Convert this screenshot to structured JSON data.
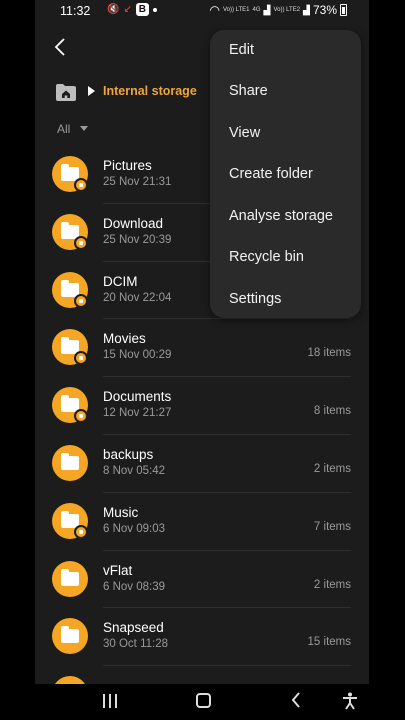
{
  "status_bar": {
    "time": "11:32",
    "battery": "73%",
    "network_labels": [
      "Vo)) LTE1",
      "4G",
      "Vo)) LTE2"
    ],
    "app_badge": "B"
  },
  "topbar": {
    "back_icon": "back-arrow-icon"
  },
  "path": {
    "home_icon": "home-folder-icon",
    "current": "Internal storage"
  },
  "filter": {
    "label": "All"
  },
  "colors": {
    "accent": "#f0a53a",
    "folder": "#f4a624",
    "background": "#1c1c1c",
    "menu_bg": "#2a2a2a"
  },
  "folders": [
    {
      "name": "Pictures",
      "date": "25 Nov 21:31",
      "count": "",
      "badge_icon": "image-icon"
    },
    {
      "name": "Download",
      "date": "25 Nov 20:39",
      "count": "",
      "badge_icon": "download-icon"
    },
    {
      "name": "DCIM",
      "date": "20 Nov 22:04",
      "count": "",
      "badge_icon": "camera-icon"
    },
    {
      "name": "Movies",
      "date": "15 Nov 00:29",
      "count": "18 items",
      "badge_icon": "play-icon"
    },
    {
      "name": "Documents",
      "date": "12 Nov 21:27",
      "count": "8 items",
      "badge_icon": "document-icon"
    },
    {
      "name": "backups",
      "date": "8 Nov 05:42",
      "count": "2 items",
      "badge_icon": ""
    },
    {
      "name": "Music",
      "date": "6 Nov 09:03",
      "count": "7 items",
      "badge_icon": "music-note-icon"
    },
    {
      "name": "vFlat",
      "date": "6 Nov 08:39",
      "count": "2 items",
      "badge_icon": ""
    },
    {
      "name": "Snapseed",
      "date": "30 Oct 11:28",
      "count": "15 items",
      "badge_icon": ""
    },
    {
      "name": "",
      "date": "",
      "count": "",
      "badge_icon": ""
    }
  ],
  "menu": {
    "items": [
      "Edit",
      "Share",
      "View",
      "Create folder",
      "Analyse storage",
      "Recycle bin",
      "Settings"
    ]
  },
  "nav_bar": {
    "recents_icon": "recent-apps-icon",
    "home_icon": "home-button-icon",
    "back_icon": "back-chevron-icon",
    "accessibility_icon": "accessibility-icon"
  }
}
